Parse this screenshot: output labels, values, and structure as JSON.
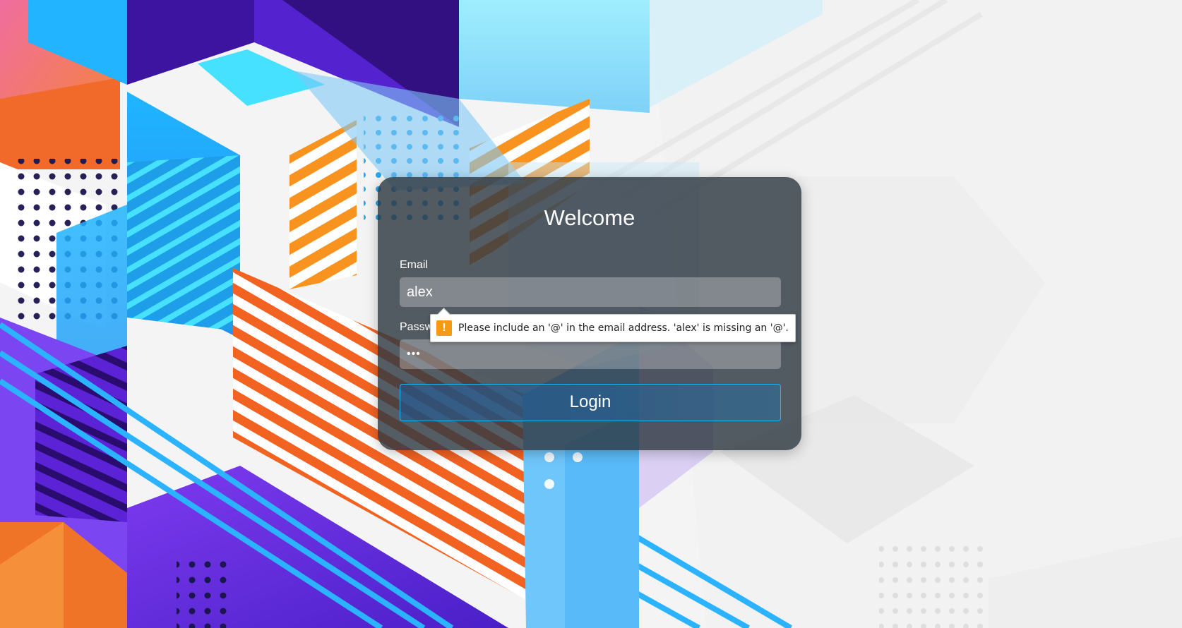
{
  "login_card": {
    "title": "Welcome",
    "email_label": "Email",
    "email_value": "alex",
    "password_label": "Password",
    "password_masked": "•••",
    "login_button": "Login"
  },
  "validation_tooltip": {
    "icon": "warning-icon",
    "icon_glyph": "!",
    "message": "Please include an '@' in the email address. 'alex' is missing an '@'."
  },
  "colors": {
    "card_background": "#2e3842",
    "button_border": "#27b2f0",
    "warning": "#f59a14"
  }
}
